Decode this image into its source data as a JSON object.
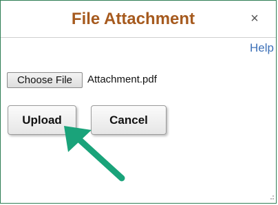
{
  "dialog": {
    "title": "File Attachment",
    "close_glyph": "×",
    "help_label": "Help"
  },
  "file_row": {
    "choose_label": "Choose File",
    "file_name": "Attachment.pdf"
  },
  "actions": {
    "upload_label": "Upload",
    "cancel_label": "Cancel"
  },
  "colors": {
    "title": "#a65a1e",
    "link": "#3d71b8",
    "annotation_arrow": "#1aa37a",
    "dialog_border": "#2e7d54"
  },
  "icons": {
    "close": "close-icon",
    "annotation": "arrow-annotation-icon",
    "grip": "resize-grip-icon"
  }
}
